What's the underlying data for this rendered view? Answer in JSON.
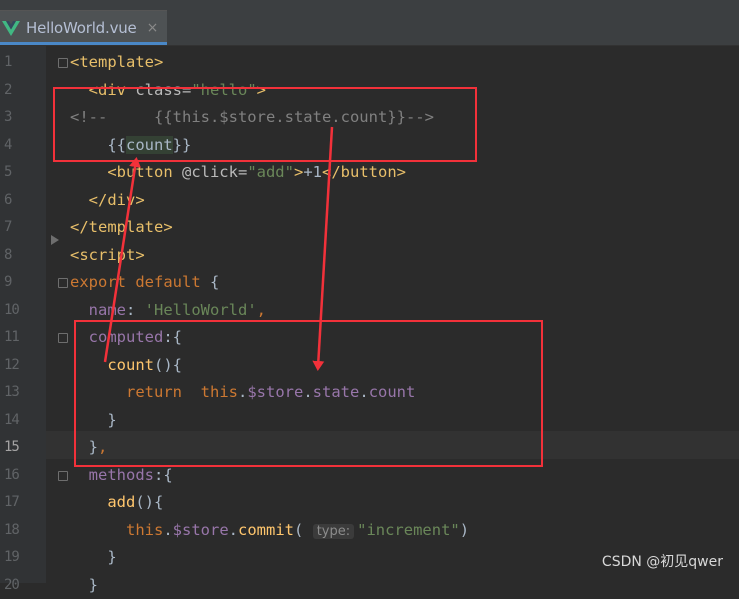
{
  "tab": {
    "title": "HelloWorld.vue",
    "close_glyph": "×",
    "icon": "vue-icon"
  },
  "colors": {
    "accent": "#4a88c7",
    "annotation": "#f2313a",
    "background": "#2b2b2b"
  },
  "code": {
    "current_line": 15,
    "lines": [
      {
        "n": "1",
        "tokens": [
          {
            "c": "t-tag",
            "t": "<template>"
          }
        ]
      },
      {
        "n": "2",
        "tokens": [
          {
            "c": "t-plain",
            "t": "  "
          },
          {
            "c": "t-tag",
            "t": "<div "
          },
          {
            "c": "t-attr",
            "t": "class="
          },
          {
            "c": "t-str",
            "t": "\"hello\""
          },
          {
            "c": "t-tag",
            "t": ">"
          }
        ]
      },
      {
        "n": "3",
        "tokens": [
          {
            "c": "t-com",
            "t": "<!--     {{this.$store.state.count}}-->"
          }
        ]
      },
      {
        "n": "4",
        "tokens": [
          {
            "c": "t-plain",
            "t": "    {{"
          },
          {
            "c": "t-hl",
            "t": "count"
          },
          {
            "c": "t-plain",
            "t": "}}"
          }
        ]
      },
      {
        "n": "5",
        "tokens": [
          {
            "c": "t-plain",
            "t": "    "
          },
          {
            "c": "t-tag",
            "t": "<button "
          },
          {
            "c": "t-attr",
            "t": "@click="
          },
          {
            "c": "t-str",
            "t": "\"add\""
          },
          {
            "c": "t-tag",
            "t": ">"
          },
          {
            "c": "t-plain",
            "t": "+1"
          },
          {
            "c": "t-tag",
            "t": "</button>"
          }
        ]
      },
      {
        "n": "6",
        "tokens": [
          {
            "c": "t-plain",
            "t": "  "
          },
          {
            "c": "t-tag",
            "t": "</div>"
          }
        ]
      },
      {
        "n": "7",
        "tokens": [
          {
            "c": "t-tag",
            "t": "</template>"
          }
        ]
      },
      {
        "n": "8",
        "tokens": [
          {
            "c": "t-tag",
            "t": "<script>"
          }
        ]
      },
      {
        "n": "9",
        "tokens": [
          {
            "c": "t-kw",
            "t": "export default "
          },
          {
            "c": "t-plain",
            "t": "{"
          }
        ]
      },
      {
        "n": "10",
        "tokens": [
          {
            "c": "t-plain",
            "t": "  "
          },
          {
            "c": "t-prop",
            "t": "name"
          },
          {
            "c": "t-plain",
            "t": ": "
          },
          {
            "c": "t-str",
            "t": "'HelloWorld'"
          },
          {
            "c": "t-kw",
            "t": ","
          }
        ]
      },
      {
        "n": "11",
        "tokens": [
          {
            "c": "t-plain",
            "t": "  "
          },
          {
            "c": "t-prop",
            "t": "computed"
          },
          {
            "c": "t-plain",
            "t": ":{"
          }
        ]
      },
      {
        "n": "12",
        "tokens": [
          {
            "c": "t-plain",
            "t": "    "
          },
          {
            "c": "t-func",
            "t": "count"
          },
          {
            "c": "t-plain",
            "t": "(){"
          }
        ]
      },
      {
        "n": "13",
        "tokens": [
          {
            "c": "t-plain",
            "t": "      "
          },
          {
            "c": "t-kw",
            "t": "return  "
          },
          {
            "c": "t-kw",
            "t": "this"
          },
          {
            "c": "t-plain",
            "t": "."
          },
          {
            "c": "t-prop",
            "t": "$store"
          },
          {
            "c": "t-plain",
            "t": "."
          },
          {
            "c": "t-prop",
            "t": "state"
          },
          {
            "c": "t-plain",
            "t": "."
          },
          {
            "c": "t-prop",
            "t": "count"
          }
        ]
      },
      {
        "n": "14",
        "tokens": [
          {
            "c": "t-plain",
            "t": "    }"
          }
        ]
      },
      {
        "n": "15",
        "tokens": [
          {
            "c": "t-plain",
            "t": "  }"
          },
          {
            "c": "t-kw",
            "t": ","
          }
        ]
      },
      {
        "n": "16",
        "tokens": [
          {
            "c": "t-plain",
            "t": "  "
          },
          {
            "c": "t-prop",
            "t": "methods"
          },
          {
            "c": "t-plain",
            "t": ":{"
          }
        ]
      },
      {
        "n": "17",
        "tokens": [
          {
            "c": "t-plain",
            "t": "    "
          },
          {
            "c": "t-func",
            "t": "add"
          },
          {
            "c": "t-plain",
            "t": "(){"
          }
        ]
      },
      {
        "n": "18",
        "tokens": [
          {
            "c": "t-plain",
            "t": "      "
          },
          {
            "c": "t-kw",
            "t": "this"
          },
          {
            "c": "t-plain",
            "t": "."
          },
          {
            "c": "t-prop",
            "t": "$store"
          },
          {
            "c": "t-plain",
            "t": "."
          },
          {
            "c": "t-func",
            "t": "commit"
          },
          {
            "c": "t-plain",
            "t": "( "
          },
          {
            "c": "hint",
            "t": "type:"
          },
          {
            "c": "t-str",
            "t": "\"increment\""
          },
          {
            "c": "t-plain",
            "t": ")"
          }
        ]
      },
      {
        "n": "19",
        "tokens": [
          {
            "c": "t-plain",
            "t": "    }"
          }
        ]
      },
      {
        "n": "20",
        "tokens": [
          {
            "c": "t-plain",
            "t": "  }"
          }
        ]
      }
    ]
  },
  "watermark": "CSDN @初见qwer"
}
